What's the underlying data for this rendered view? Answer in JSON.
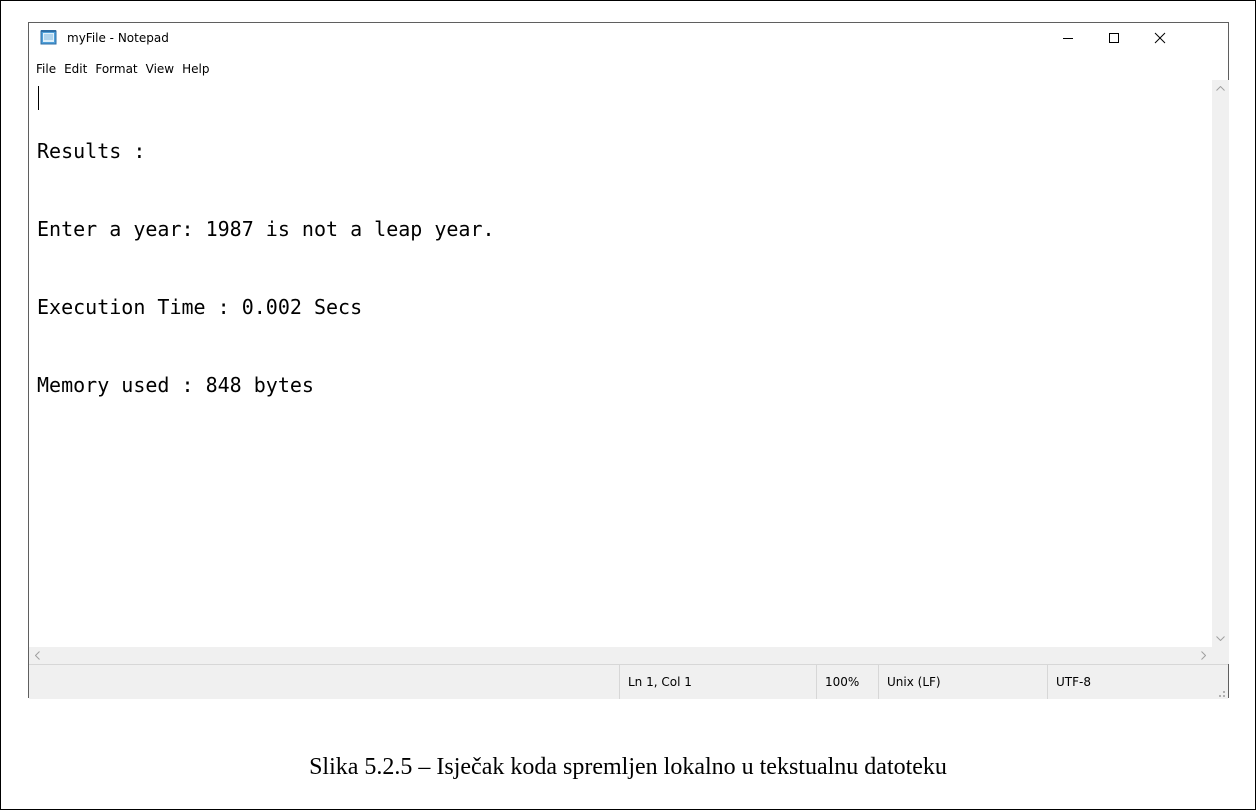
{
  "window": {
    "title": "myFile - Notepad",
    "minimize_glyph": "–",
    "maximize_glyph": "□",
    "close_glyph": "✕"
  },
  "menu": {
    "items": [
      {
        "label": "File"
      },
      {
        "label": "Edit"
      },
      {
        "label": "Format"
      },
      {
        "label": "View"
      },
      {
        "label": "Help"
      }
    ]
  },
  "editor": {
    "lines": [
      "Results :",
      "Enter a year: 1987 is not a leap year.",
      "Execution Time : 0.002 Secs",
      "Memory used : 848 bytes"
    ]
  },
  "statusbar": {
    "position": "Ln 1, Col 1",
    "zoom": "100%",
    "line_ending": "Unix (LF)",
    "encoding": "UTF-8"
  },
  "caption": "Slika 5.2.5 – Isječak koda spremljen lokalno u tekstualnu datoteku",
  "icons": {
    "app": "notepad-icon",
    "scroll_up": "chevron-up-icon",
    "scroll_down": "chevron-down-icon",
    "scroll_left": "chevron-left-icon",
    "scroll_right": "chevron-right-icon",
    "grip": "resize-grip-icon"
  },
  "colors": {
    "chrome": "#f0f0f0",
    "border": "#5f5f5f",
    "text": "#000000"
  }
}
